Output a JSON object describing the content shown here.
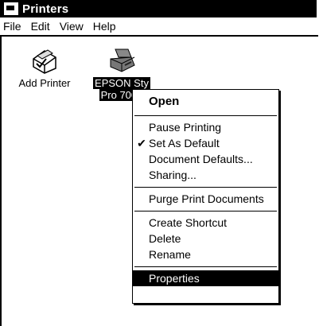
{
  "window": {
    "title": "Printers"
  },
  "menubar": [
    "File",
    "Edit",
    "View",
    "Help"
  ],
  "icons": {
    "add_printer": "Add Printer",
    "epson_line1": "EPSON Sty",
    "epson_line2": "Pro 7000"
  },
  "context_menu": {
    "open": "Open",
    "pause": "Pause Printing",
    "set_default": "Set As Default",
    "doc_defaults": "Document Defaults...",
    "sharing": "Sharing...",
    "purge": "Purge Print Documents",
    "create_shortcut": "Create Shortcut",
    "delete": "Delete",
    "rename": "Rename",
    "properties": "Properties"
  }
}
